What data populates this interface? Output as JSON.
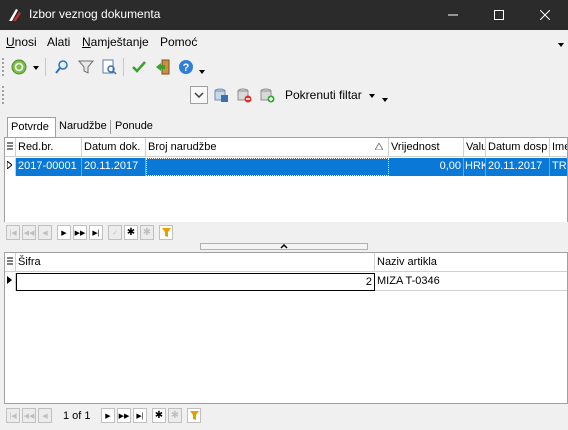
{
  "window": {
    "title": "Izbor veznog dokumenta"
  },
  "menu": [
    {
      "label": "Unosi",
      "underline": "U",
      "rest": "nosi"
    },
    {
      "label": "Alati",
      "underline": "A",
      "rest": "lati"
    },
    {
      "label": "Namještanje",
      "underline": "N",
      "rest": "amještanje"
    },
    {
      "label": "Pomoć",
      "underline": "P",
      "rest": "omoć"
    }
  ],
  "filter": {
    "label": "Pokrenuti filtar"
  },
  "tabs": [
    {
      "label": "Potvrde",
      "active": true
    },
    {
      "label": "Narudžbe",
      "active": false
    },
    {
      "label": "Ponude",
      "active": false
    }
  ],
  "top_grid": {
    "columns": [
      "Red.br.",
      "Datum dok.",
      "Broj narudžbe",
      "Vrijednost",
      "Valu",
      "Datum dosp",
      "Ime"
    ],
    "rows": [
      {
        "red_br": "2017-00001",
        "datum_dok": "20.11.2017",
        "broj_narudzbe": "",
        "vrijednost": "0,00",
        "valuta": "HRK",
        "datum_dosp": "20.11.2017",
        "ime": "TRO"
      }
    ]
  },
  "bottom_grid": {
    "columns": [
      "Šifra",
      "Naziv artikla"
    ],
    "rows": [
      {
        "sifra": "2",
        "naziv": "MIZA T-0346"
      }
    ]
  },
  "bottom_nav": {
    "page_text": "1 of 1"
  },
  "colors": {
    "selection": "#0a78d7",
    "titlebar": "#2b2b2b",
    "filter_icon": "#e8a000"
  }
}
